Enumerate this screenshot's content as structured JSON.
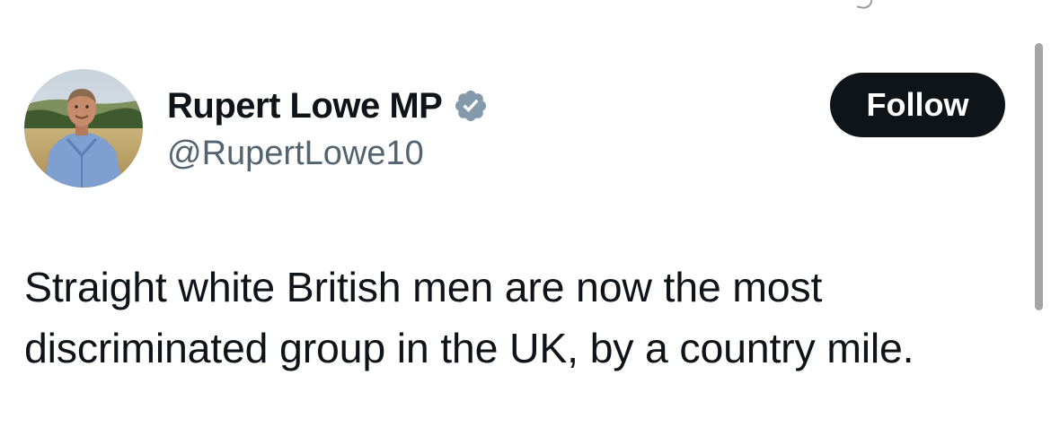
{
  "tweet": {
    "author": {
      "display_name": "Rupert Lowe MP",
      "handle": "@RupertLowe10",
      "verified_icon": "verified-badge-icon",
      "verified_color": "#829aab"
    },
    "follow_button": {
      "label": "Follow",
      "background": "#0f1419",
      "text_color": "#ffffff"
    },
    "text_lines": [
      "Straight white British men are now the most",
      "discriminated group in the UK, by a country mile."
    ]
  },
  "colors": {
    "primary_text": "#0f1419",
    "secondary_text": "#536471",
    "background": "#ffffff"
  }
}
